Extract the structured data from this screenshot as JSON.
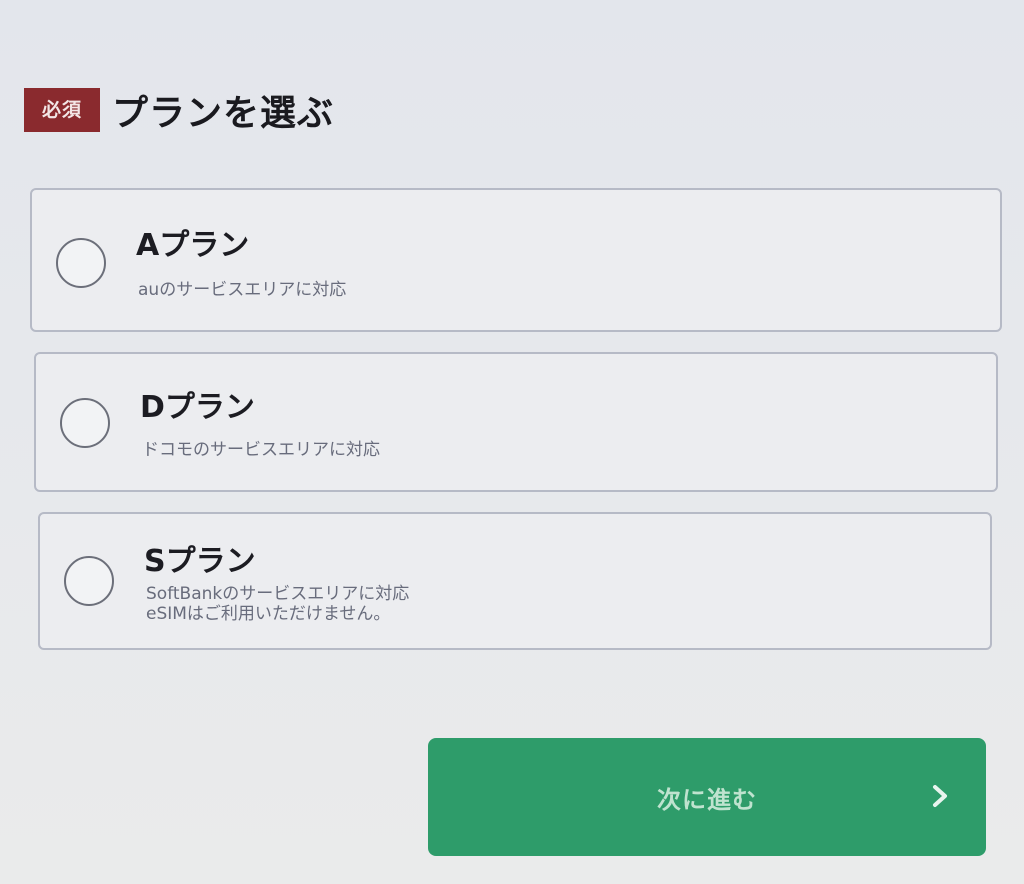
{
  "header": {
    "badge": "必須",
    "title": "プランを選ぶ"
  },
  "plans": [
    {
      "name": "Aプラン",
      "desc": [
        "auのサービスエリアに対応"
      ],
      "selected": false
    },
    {
      "name": "Dプラン",
      "desc": [
        "ドコモのサービスエリアに対応"
      ],
      "selected": false
    },
    {
      "name": "Sプラン",
      "desc": [
        "SoftBankのサービスエリアに対応",
        "eSIMはご利用いただけません。"
      ],
      "selected": false
    }
  ],
  "next_button": {
    "label": "次に進む",
    "icon": "chevron-right-icon"
  },
  "colors": {
    "badge_bg": "#8a2a2e",
    "button_bg": "#2e9c6a",
    "button_text": "#bfe3cf"
  }
}
